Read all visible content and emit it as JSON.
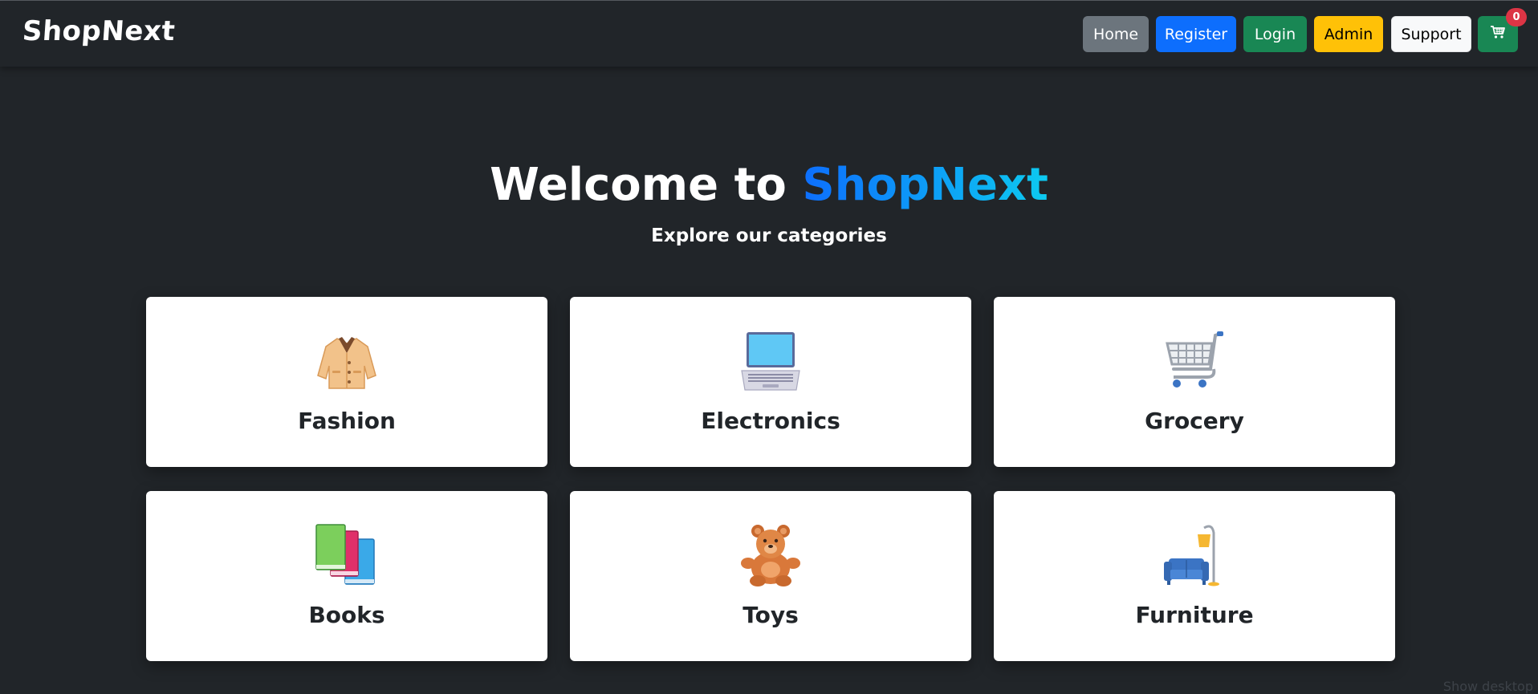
{
  "nav": {
    "brand": "ShopNext",
    "home": "Home",
    "register": "Register",
    "login": "Login",
    "admin": "Admin",
    "support": "Support",
    "cart_count": "0"
  },
  "hero": {
    "title_prefix": "Welcome to ",
    "title_brand": "ShopNext",
    "subtitle": "Explore our categories"
  },
  "categories": [
    {
      "label": "Fashion",
      "icon": "coat-icon"
    },
    {
      "label": "Electronics",
      "icon": "laptop-icon"
    },
    {
      "label": "Grocery",
      "icon": "shopping-cart-icon"
    },
    {
      "label": "Books",
      "icon": "books-icon"
    },
    {
      "label": "Toys",
      "icon": "teddy-bear-icon"
    },
    {
      "label": "Furniture",
      "icon": "couch-and-lamp-icon"
    }
  ],
  "footer": {
    "show_desktop": "Show desktop"
  },
  "colors": {
    "background": "#212529",
    "home_button": "#6c757d",
    "register_button": "#0d6efd",
    "login_button": "#198754",
    "admin_button": "#ffc107",
    "support_button": "#f8f9fa",
    "cart_button": "#198754",
    "cart_badge": "#dc3545",
    "brand_gradient_start": "#0d6efd",
    "brand_gradient_end": "#0dcaf0"
  }
}
